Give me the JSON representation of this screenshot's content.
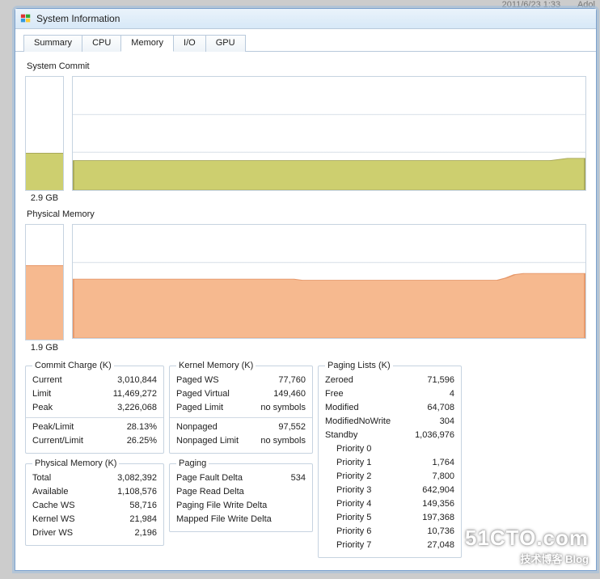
{
  "topright": {
    "timestamp": "2011/6/23 1:33",
    "app": "Adol"
  },
  "window": {
    "title": "System Information"
  },
  "tabs": [
    "Summary",
    "CPU",
    "Memory",
    "I/O",
    "GPU"
  ],
  "active_tab": 2,
  "sections": {
    "commit_title": "System Commit",
    "physmem_title": "Physical Memory"
  },
  "gauges": {
    "commit": {
      "label": "2.9 GB",
      "fill_pct": 32,
      "color": "#cdcf6f",
      "border": "#a8a85a"
    },
    "physmem": {
      "label": "1.9 GB",
      "fill_pct": 64,
      "color": "#f6b98f",
      "border": "#e6986a"
    }
  },
  "chart_data": [
    {
      "type": "area",
      "name": "system-commit-timeline",
      "ylim": [
        0,
        100
      ],
      "fill": "#cdcf6f",
      "stroke": "#a8a85a",
      "values": [
        26,
        26,
        26,
        26,
        26,
        26,
        26,
        26,
        26,
        26,
        26,
        26,
        26,
        26,
        26,
        26,
        26,
        26,
        26,
        26,
        26,
        26,
        26,
        26,
        26,
        26,
        26,
        26,
        26,
        26,
        26,
        26,
        26,
        26,
        26,
        26,
        26,
        26,
        26,
        26,
        26,
        26,
        26,
        26,
        26,
        26,
        26,
        26,
        26,
        26,
        26,
        26,
        26,
        26,
        26,
        27,
        28,
        28,
        28
      ]
    },
    {
      "type": "area",
      "name": "physical-memory-timeline",
      "ylim": [
        0,
        100
      ],
      "fill": "#f6b98f",
      "stroke": "#e6986a",
      "values": [
        52,
        52,
        52,
        52,
        52,
        52,
        52,
        52,
        52,
        52,
        52,
        52,
        52,
        52,
        52,
        52,
        52,
        52,
        52,
        52,
        52,
        52,
        52,
        52,
        52,
        52,
        51,
        51,
        51,
        51,
        51,
        51,
        51,
        51,
        51,
        51,
        51,
        51,
        51,
        51,
        51,
        51,
        51,
        51,
        51,
        51,
        51,
        51,
        51,
        53,
        56,
        57,
        57,
        57,
        57,
        57,
        57,
        57,
        57
      ]
    }
  ],
  "groups": {
    "commitCharge": {
      "legend": "Commit Charge (K)",
      "rows1": [
        {
          "k": "Current",
          "v": "3,010,844"
        },
        {
          "k": "Limit",
          "v": "11,469,272"
        },
        {
          "k": "Peak",
          "v": "3,226,068"
        }
      ],
      "rows2": [
        {
          "k": "Peak/Limit",
          "v": "28.13%"
        },
        {
          "k": "Current/Limit",
          "v": "26.25%"
        }
      ]
    },
    "physMem": {
      "legend": "Physical Memory (K)",
      "rows": [
        {
          "k": "Total",
          "v": "3,082,392"
        },
        {
          "k": "Available",
          "v": "1,108,576"
        },
        {
          "k": "Cache WS",
          "v": "58,716"
        },
        {
          "k": "Kernel WS",
          "v": "21,984"
        },
        {
          "k": "Driver WS",
          "v": "2,196"
        }
      ]
    },
    "kernelMem": {
      "legend": "Kernel Memory (K)",
      "rows1": [
        {
          "k": "Paged WS",
          "v": "77,760"
        },
        {
          "k": "Paged Virtual",
          "v": "149,460"
        },
        {
          "k": "Paged Limit",
          "v": "no symbols"
        }
      ],
      "rows2": [
        {
          "k": "Nonpaged",
          "v": "97,552"
        },
        {
          "k": "Nonpaged Limit",
          "v": "no symbols"
        }
      ]
    },
    "paging": {
      "legend": "Paging",
      "rows": [
        {
          "k": "Page Fault Delta",
          "v": "534"
        },
        {
          "k": "Page Read Delta",
          "v": ""
        },
        {
          "k": "Paging File Write Delta",
          "v": ""
        },
        {
          "k": "Mapped File Write Delta",
          "v": ""
        }
      ]
    },
    "pagingLists": {
      "legend": "Paging Lists (K)",
      "rows": [
        {
          "k": "Zeroed",
          "v": "71,596"
        },
        {
          "k": "Free",
          "v": "4"
        },
        {
          "k": "Modified",
          "v": "64,708"
        },
        {
          "k": "ModifiedNoWrite",
          "v": "304"
        },
        {
          "k": "Standby",
          "v": "1,036,976"
        },
        {
          "k": "Priority 0",
          "v": ""
        },
        {
          "k": "Priority 1",
          "v": "1,764"
        },
        {
          "k": "Priority 2",
          "v": "7,800"
        },
        {
          "k": "Priority 3",
          "v": "642,904"
        },
        {
          "k": "Priority 4",
          "v": "149,356"
        },
        {
          "k": "Priority 5",
          "v": "197,368"
        },
        {
          "k": "Priority 6",
          "v": "10,736"
        },
        {
          "k": "Priority 7",
          "v": "27,048"
        }
      ],
      "indentFrom": 5
    }
  },
  "watermark": {
    "big": "51CTO.com",
    "small": "技术博客  Blog"
  }
}
